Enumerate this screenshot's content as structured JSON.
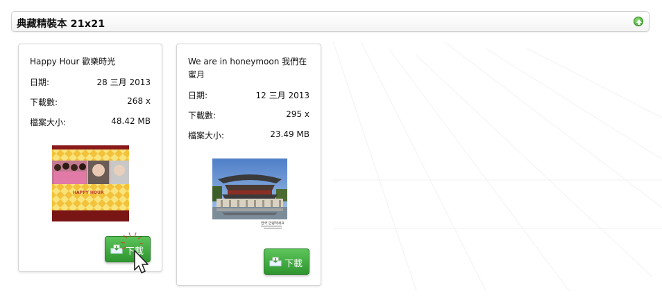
{
  "page": {
    "title": "典藏精裝本 21x21"
  },
  "cards": [
    {
      "title": "Happy Hour 歡樂時光",
      "date_label": "日期:",
      "date_value": "28 三月 2013",
      "downloads_label": "下載數:",
      "downloads_value": "268 x",
      "size_label": "檔案大小:",
      "size_value": "48.42 MB",
      "thumbnail_text": "HAPPY HOUR",
      "download_label": "下載"
    },
    {
      "title_line1": "We are in honeymoon 我們在",
      "title_line2": "蜜月",
      "date_label": "日期:",
      "date_value": "12 三月 2013",
      "downloads_label": "下載數:",
      "downloads_value": "295 x",
      "size_label": "檔案大小:",
      "size_value": "23.49 MB",
      "thumbnail_caption": "한국 안녕하세요",
      "download_label": "下載"
    }
  ],
  "colors": {
    "download_button": "#3aa83a",
    "collapse_icon": "#4caf3a"
  }
}
